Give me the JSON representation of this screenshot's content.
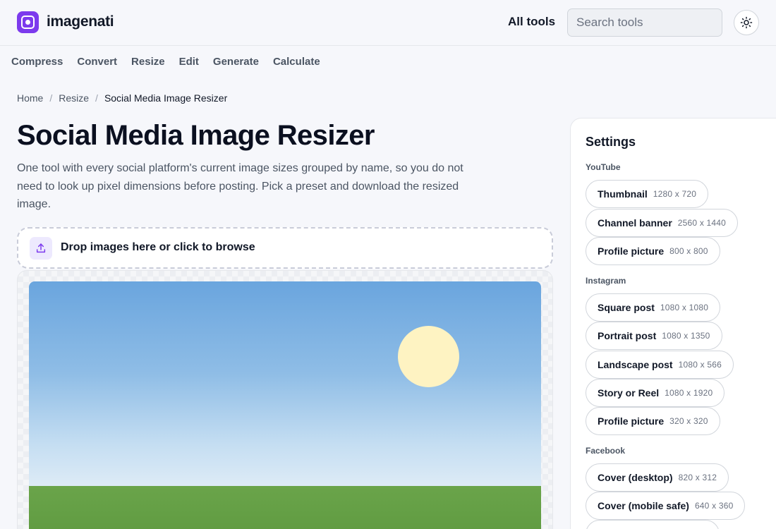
{
  "header": {
    "brand": "imagenati",
    "all_tools": "All tools",
    "search_placeholder": "Search tools",
    "theme_icon": "sun-icon"
  },
  "nav": [
    "Compress",
    "Convert",
    "Resize",
    "Edit",
    "Generate",
    "Calculate"
  ],
  "breadcrumb": {
    "home": "Home",
    "section": "Resize",
    "current": "Social Media Image Resizer"
  },
  "page": {
    "title": "Social Media Image Resizer",
    "description": "One tool with every social platform's current image sizes grouped by name, so you do not need to look up pixel dimensions before posting. Pick a preset and download the resized image."
  },
  "dropzone": {
    "label": "Drop images here or click to browse",
    "icon": "upload-icon"
  },
  "settings": {
    "title": "Settings",
    "groups": [
      {
        "name": "YouTube",
        "presets": [
          {
            "name": "Thumbnail",
            "dims": "1280 x 720"
          },
          {
            "name": "Channel banner",
            "dims": "2560 x 1440"
          },
          {
            "name": "Profile picture",
            "dims": "800 x 800"
          }
        ]
      },
      {
        "name": "Instagram",
        "presets": [
          {
            "name": "Square post",
            "dims": "1080 x 1080"
          },
          {
            "name": "Portrait post",
            "dims": "1080 x 1350"
          },
          {
            "name": "Landscape post",
            "dims": "1080 x 566"
          },
          {
            "name": "Story or Reel",
            "dims": "1080 x 1920"
          },
          {
            "name": "Profile picture",
            "dims": "320 x 320"
          }
        ]
      },
      {
        "name": "Facebook",
        "presets": [
          {
            "name": "Cover (desktop)",
            "dims": "820 x 312"
          },
          {
            "name": "Cover (mobile safe)",
            "dims": "640 x 360"
          }
        ]
      }
    ]
  },
  "colors": {
    "accent": "#7c3aed",
    "accent_soft": "#ede9fe",
    "background": "#f6f7fb",
    "text": "#111827"
  }
}
